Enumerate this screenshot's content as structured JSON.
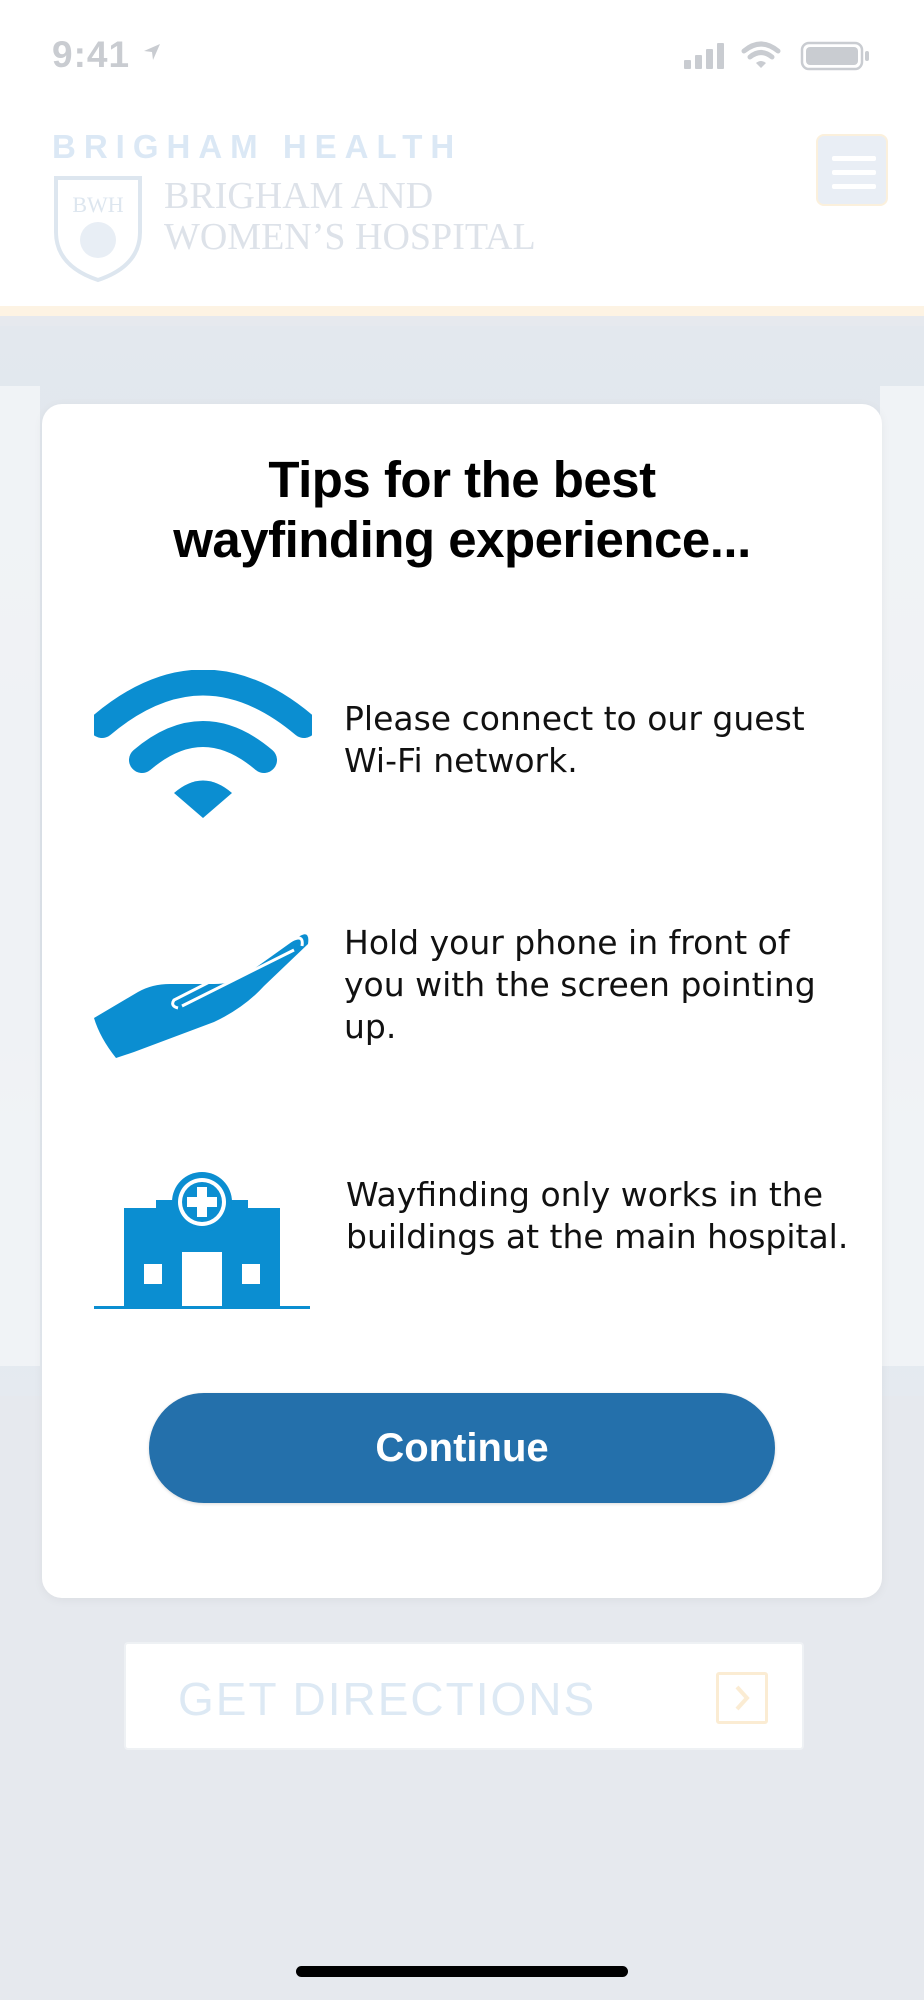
{
  "status_bar": {
    "time": "9:41",
    "icons": [
      "location-arrow-icon",
      "cellular-signal-icon",
      "wifi-icon",
      "battery-icon"
    ]
  },
  "header": {
    "brand_top": "BRIGHAM HEALTH",
    "shield_text": "BWH",
    "brand_line1": "BRIGHAM AND",
    "brand_line2": "WOMEN’S HOSPITAL",
    "menu_icon": "hamburger-menu-icon"
  },
  "modal": {
    "title_line1": "Tips for the best",
    "title_line2": "wayfinding experience...",
    "tips": [
      {
        "icon": "wifi-icon",
        "text": "Please connect to our guest Wi-Fi network."
      },
      {
        "icon": "hand-holding-phone-icon",
        "text": "Hold your phone in front of you with the screen pointing up."
      },
      {
        "icon": "hospital-building-icon",
        "text": "Wayfinding only works in the buildings at the main hospital."
      }
    ],
    "continue_label": "Continue"
  },
  "background": {
    "get_directions_label": "GET DIRECTIONS",
    "get_directions_icon": "chevron-right-icon"
  },
  "colors": {
    "accent_blue": "#0b8ed1",
    "button_blue": "#2470ab",
    "title_black": "#000000"
  }
}
